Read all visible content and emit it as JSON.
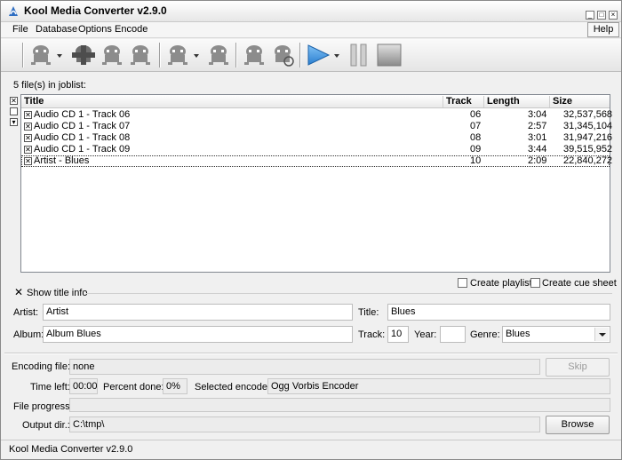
{
  "window": {
    "title": "Kool Media Converter v2.9.0"
  },
  "menu": {
    "items": [
      "File",
      "Database",
      "Options",
      "Encode"
    ],
    "help": "Help"
  },
  "toolbar": {
    "buttons": [
      "add-files",
      "add-cd",
      "edit",
      "remove",
      "database",
      "tag",
      "lookup",
      "convert",
      "play",
      "pause",
      "stop"
    ]
  },
  "joblist": {
    "count_label": "5 file(s) in joblist:",
    "columns": {
      "title": "Title",
      "track": "Track",
      "length": "Length",
      "size": "Size"
    },
    "rows": [
      {
        "title": "Audio CD 1 - Track 06",
        "track": "06",
        "length": "3:04",
        "size": "32,537,568",
        "checked": true
      },
      {
        "title": "Audio CD 1 - Track 07",
        "track": "07",
        "length": "2:57",
        "size": "31,345,104",
        "checked": true
      },
      {
        "title": "Audio CD 1 - Track 08",
        "track": "08",
        "length": "3:01",
        "size": "31,947,216",
        "checked": true
      },
      {
        "title": "Audio CD 1 - Track 09",
        "track": "09",
        "length": "3:44",
        "size": "39,515,952",
        "checked": true
      },
      {
        "title": "Artist - Blues",
        "track": "10",
        "length": "2:09",
        "size": "22,840,272",
        "checked": true,
        "selected": true
      }
    ]
  },
  "options": {
    "create_playlist": "Create playlist",
    "create_cue_sheet": "Create cue sheet"
  },
  "title_info": {
    "toggle_label": "Show title info",
    "artist_label": "Artist:",
    "artist_value": "Artist",
    "title_label": "Title:",
    "title_value": "Blues",
    "album_label": "Album:",
    "album_value": "Album Blues",
    "track_label": "Track:",
    "track_value": "10",
    "year_label": "Year:",
    "year_value": "",
    "genre_label": "Genre:",
    "genre_value": "Blues"
  },
  "encoding": {
    "encoding_file_label": "Encoding file:",
    "encoding_file_value": "none",
    "skip_label": "Skip",
    "time_left_label": "Time left:",
    "time_left_value": "00:00",
    "percent_label": "Percent done:",
    "percent_value": "0%",
    "encoder_label": "Selected encoder:",
    "encoder_value": "Ogg Vorbis Encoder",
    "file_progress_label": "File progress:",
    "output_dir_label": "Output dir.:",
    "output_dir_value": "C:\\tmp\\",
    "browse_label": "Browse"
  },
  "status": {
    "text": "Kool Media Converter v2.9.0"
  },
  "colors": {
    "accent": "#3b8fd8",
    "icon_gray": "#8c8c8c"
  }
}
